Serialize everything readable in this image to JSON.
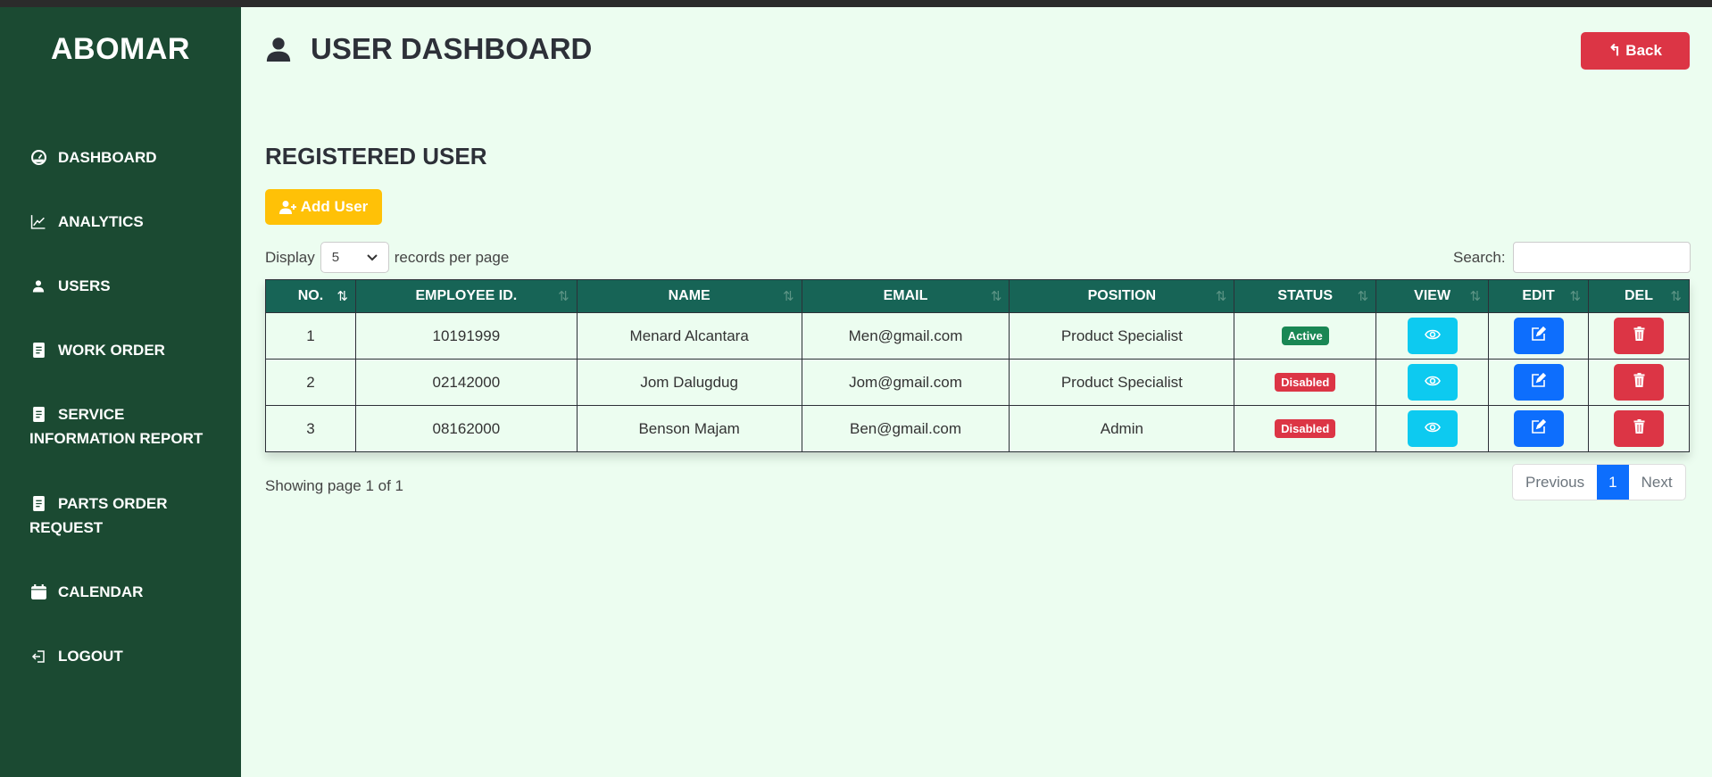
{
  "sidebar": {
    "logo": "ABOMAR",
    "items": [
      {
        "label": "DASHBOARD",
        "icon": "gauge-icon"
      },
      {
        "label": "ANALYTICS",
        "icon": "chart-line-icon"
      },
      {
        "label": "USERS",
        "icon": "user-icon"
      },
      {
        "label": "WORK ORDER",
        "icon": "document-icon"
      },
      {
        "label": "SERVICE INFORMATION REPORT",
        "icon": "document-icon"
      },
      {
        "label": "PARTS ORDER REQUEST",
        "icon": "document-icon"
      },
      {
        "label": "CALENDAR",
        "icon": "calendar-icon"
      },
      {
        "label": "LOGOUT",
        "icon": "logout-icon"
      }
    ]
  },
  "header": {
    "title": "USER DASHBOARD",
    "back_label": "Back"
  },
  "section_title": "REGISTERED USER",
  "add_user_label": "Add User",
  "display": {
    "prefix": "Display",
    "value": "5",
    "suffix": "records per page"
  },
  "search": {
    "label": "Search:",
    "value": ""
  },
  "table": {
    "columns": [
      "NO.",
      "EMPLOYEE ID.",
      "NAME",
      "EMAIL",
      "POSITION",
      "STATUS",
      "VIEW",
      "EDIT",
      "DEL"
    ],
    "rows": [
      {
        "no": "1",
        "id": "10191999",
        "name": "Menard Alcantara",
        "email": "Men@gmail.com",
        "position": "Product Specialist",
        "status": "Active"
      },
      {
        "no": "2",
        "id": "02142000",
        "name": "Jom Dalugdug",
        "email": "Jom@gmail.com",
        "position": "Product Specialist",
        "status": "Disabled"
      },
      {
        "no": "3",
        "id": "08162000",
        "name": "Benson Majam",
        "email": "Ben@gmail.com",
        "position": "Admin",
        "status": "Disabled"
      }
    ]
  },
  "footer": {
    "showing": "Showing page 1 of 1",
    "previous": "Previous",
    "page": "1",
    "next": "Next"
  },
  "colors": {
    "sidebar": "#1b4a32",
    "header": "#176456",
    "active": "#198754",
    "disabled": "#dc3545",
    "view": "#0dcaf0",
    "edit": "#0d6efd",
    "del": "#dc3545"
  }
}
